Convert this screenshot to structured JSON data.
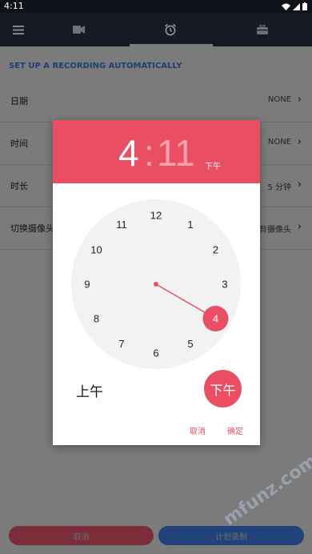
{
  "status_bar": {
    "time": "4:11"
  },
  "toolbar": {
    "icons": [
      "menu-icon",
      "video-camera-icon",
      "alarm-clock-icon",
      "briefcase-icon"
    ]
  },
  "settings": {
    "section_title": "SET UP A RECORDING AUTOMATICALLY",
    "rows": [
      {
        "label": "日期",
        "value": "NONE"
      },
      {
        "label": "时间",
        "value": "NONE"
      },
      {
        "label": "时长",
        "value": "5 分钟"
      },
      {
        "label": "切换摄像头",
        "value": "背摄像头"
      }
    ]
  },
  "bottom": {
    "cancel_label": "取消",
    "schedule_label": "计划录制"
  },
  "watermark": {
    "text": "mfunz.com 魔趣网"
  },
  "dialog": {
    "hour": "4",
    "colon": ":",
    "minute": "11",
    "header_ampm": "下午",
    "clock_numbers": [
      "12",
      "1",
      "2",
      "3",
      "4",
      "5",
      "6",
      "7",
      "8",
      "9",
      "10",
      "11"
    ],
    "selected_hour": 4,
    "am_label": "上午",
    "pm_label": "下午",
    "cancel_label": "取消",
    "ok_label": "确定",
    "accent_color": "#e94e63"
  }
}
